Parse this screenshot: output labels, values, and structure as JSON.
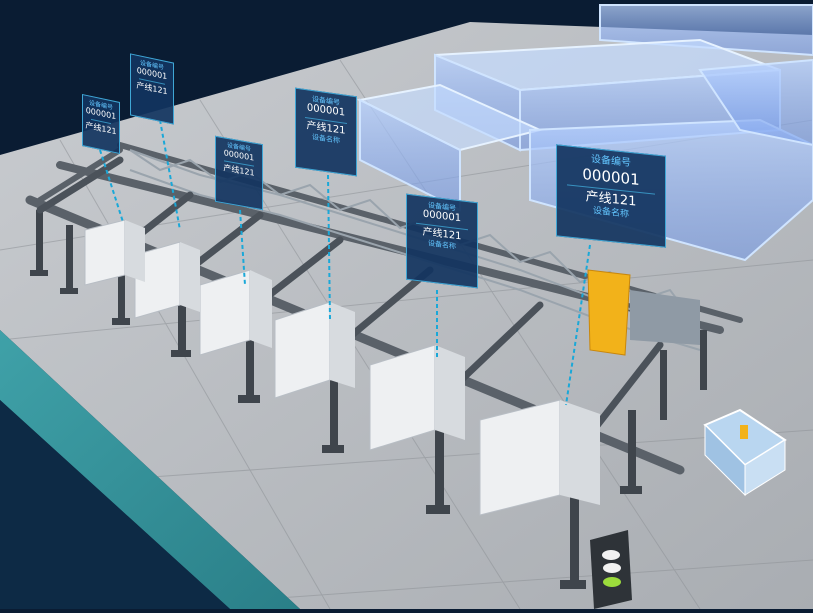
{
  "devices": [
    {
      "label": "设备编号",
      "code": "000001",
      "line": "产线121",
      "status": "设备名称"
    },
    {
      "label": "设备编号",
      "code": "000001",
      "line": "产线121",
      "status": "设备名称"
    },
    {
      "label": "设备编号",
      "code": "000001",
      "line": "产线121",
      "status": "设备名称"
    },
    {
      "label": "设备编号",
      "code": "000001",
      "line": "产线121",
      "status": "设备名称"
    },
    {
      "label": "设备编号",
      "code": "000001",
      "line": "产线121",
      "status": "设备名称"
    },
    {
      "label": "设备编号",
      "code": "000001",
      "line": "产线121",
      "status": "设备名称"
    }
  ],
  "colors": {
    "background": "#0a1c33",
    "floor": "#b9bcc0",
    "teal_zone": "#2f8a93",
    "tag_bg": "#12345f",
    "tag_border": "#3fa7d6",
    "highlight": "#f2b21a",
    "holo": "#7fb3ff"
  }
}
